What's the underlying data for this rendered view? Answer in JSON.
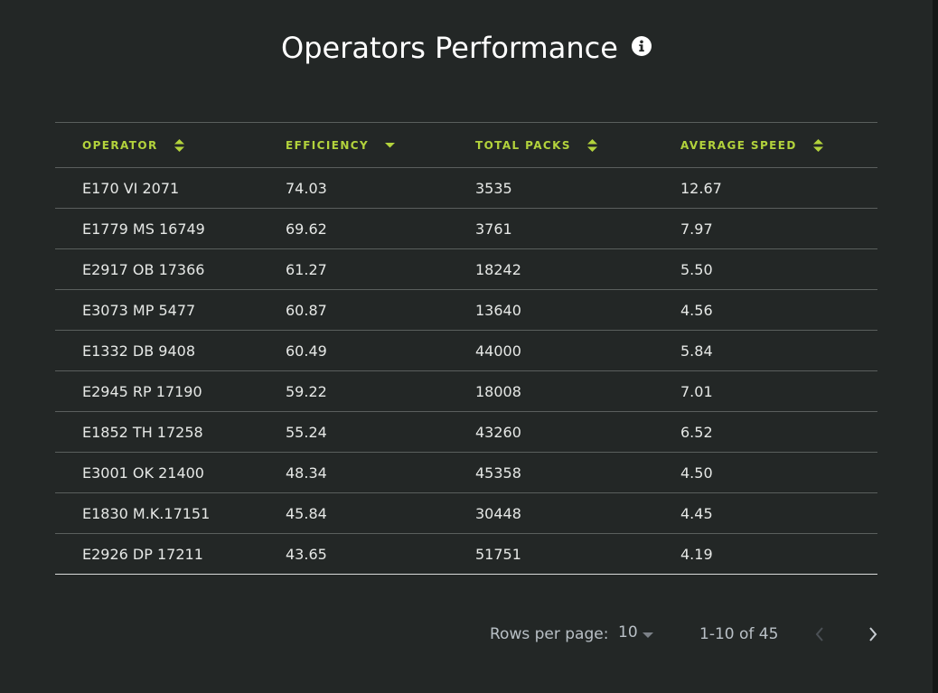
{
  "header": {
    "title": "Operators Performance",
    "info_icon": "info-circle-icon"
  },
  "table": {
    "columns": [
      {
        "label": "OPERATOR",
        "sort": "both"
      },
      {
        "label": "EFFICIENCY",
        "sort": "desc"
      },
      {
        "label": "TOTAL PACKS",
        "sort": "both"
      },
      {
        "label": "AVERAGE SPEED",
        "sort": "both"
      }
    ],
    "rows": [
      [
        "E170 VI 2071",
        "74.03",
        "3535",
        "12.67"
      ],
      [
        "E1779 MS 16749",
        "69.62",
        "3761",
        "7.97"
      ],
      [
        "E2917 OB 17366",
        "61.27",
        "18242",
        "5.50"
      ],
      [
        "E3073 MP 5477",
        "60.87",
        "13640",
        "4.56"
      ],
      [
        "E1332 DB 9408",
        "60.49",
        "44000",
        "5.84"
      ],
      [
        "E2945 RP 17190",
        "59.22",
        "18008",
        "7.01"
      ],
      [
        "E1852 TH 17258",
        "55.24",
        "43260",
        "6.52"
      ],
      [
        "E3001 OK 21400",
        "48.34",
        "45358",
        "4.50"
      ],
      [
        "E1830 M.K.17151",
        "45.84",
        "30448",
        "4.45"
      ],
      [
        "E2926 DP 17211",
        "43.65",
        "51751",
        "4.19"
      ]
    ]
  },
  "pagination": {
    "rows_per_page_label": "Rows per page:",
    "rows_per_page_value": "10",
    "range_text": "1-10 of 45",
    "prev_icon": "chevron-left-icon",
    "next_icon": "chevron-right-icon"
  },
  "colors": {
    "background": "#232726",
    "accent": "#b3d33c",
    "text": "#e6e8e6",
    "divider": "#5a5f5d"
  }
}
